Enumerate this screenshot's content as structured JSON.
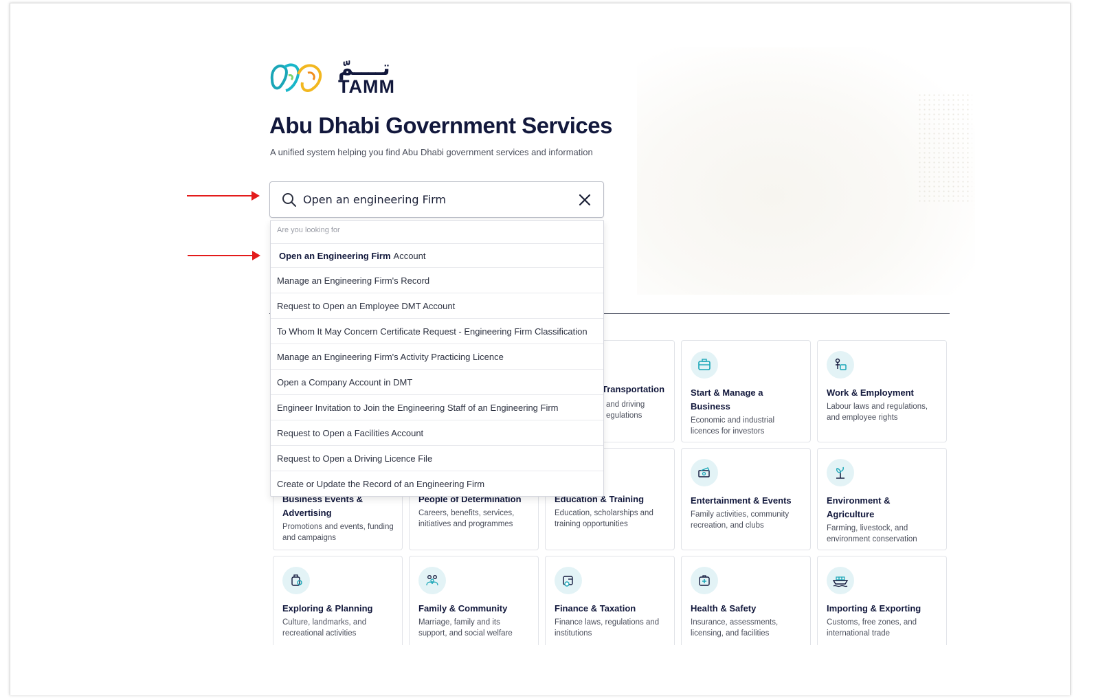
{
  "brand": {
    "logo_arabic": "تــــمّ",
    "logo_english": "TAMM"
  },
  "hero": {
    "title": "Abu Dhabi Government Services",
    "subtitle": "A unified system helping you find Abu Dhabi government services and information"
  },
  "search": {
    "value": "Open an engineering Firm"
  },
  "suggestions": {
    "header": "Are you looking for",
    "first": {
      "bold": "Open an Engineering Firm",
      "rest": "Account"
    },
    "items": [
      "Manage an Engineering Firm's Record",
      "Request to Open an Employee DMT Account",
      "To Whom It May Concern Certificate Request - Engineering Firm Classification",
      "Manage an Engineering Firm's Activity Practicing Licence",
      "Open a Company Account in DMT",
      "Engineer Invitation to Join the Engineering Staff of an Engineering Firm",
      "Request to Open a Facilities Account",
      "Request to Open a Driving Licence File",
      "Create or Update the Record of an Engineering Firm"
    ]
  },
  "categories": {
    "row1": [
      {
        "title": "Transportation",
        "desc": "and driving egulations",
        "icon": "car-icon"
      },
      {
        "title": "Start & Manage a Business",
        "desc": "Economic and industrial licences for investors",
        "icon": "briefcase-icon"
      },
      {
        "title": "Work & Employment",
        "desc": "Labour laws and regulations, and employee rights",
        "icon": "worker-icon"
      }
    ],
    "row2": [
      {
        "title": "Business Events & Advertising",
        "desc": "Promotions and events, funding and campaigns",
        "icon": "megaphone-icon"
      },
      {
        "title": "People of Determination",
        "desc": "Careers, benefits, services, initiatives and programmes",
        "icon": "accessibility-icon"
      },
      {
        "title": "Education & Training",
        "desc": "Education, scholarships and training opportunities",
        "icon": "graduation-icon"
      },
      {
        "title": "Entertainment & Events",
        "desc": "Family activities, community recreation, and clubs",
        "icon": "tickets-icon"
      },
      {
        "title": "Environment & Agriculture",
        "desc": "Farming, livestock, and environment conservation",
        "icon": "plant-icon"
      }
    ],
    "row3": [
      {
        "title": "Exploring & Planning",
        "desc": "Culture, landmarks, and recreational activities",
        "icon": "luggage-icon"
      },
      {
        "title": "Family & Community",
        "desc": "Marriage, family and its support, and social welfare",
        "icon": "family-icon"
      },
      {
        "title": "Finance & Taxation",
        "desc": "Finance laws, regulations and institutions",
        "icon": "wallet-icon"
      },
      {
        "title": "Health & Safety",
        "desc": "Insurance, assessments, licensing, and facilities",
        "icon": "first-aid-icon"
      },
      {
        "title": "Importing & Exporting",
        "desc": "Customs, free zones, and international trade",
        "icon": "ship-icon"
      }
    ]
  },
  "colors": {
    "navy": "#12183c",
    "annotation_red": "#e31b1b",
    "icon_bg": "#e3f3f6",
    "icon_teal": "#1aa6b7"
  }
}
